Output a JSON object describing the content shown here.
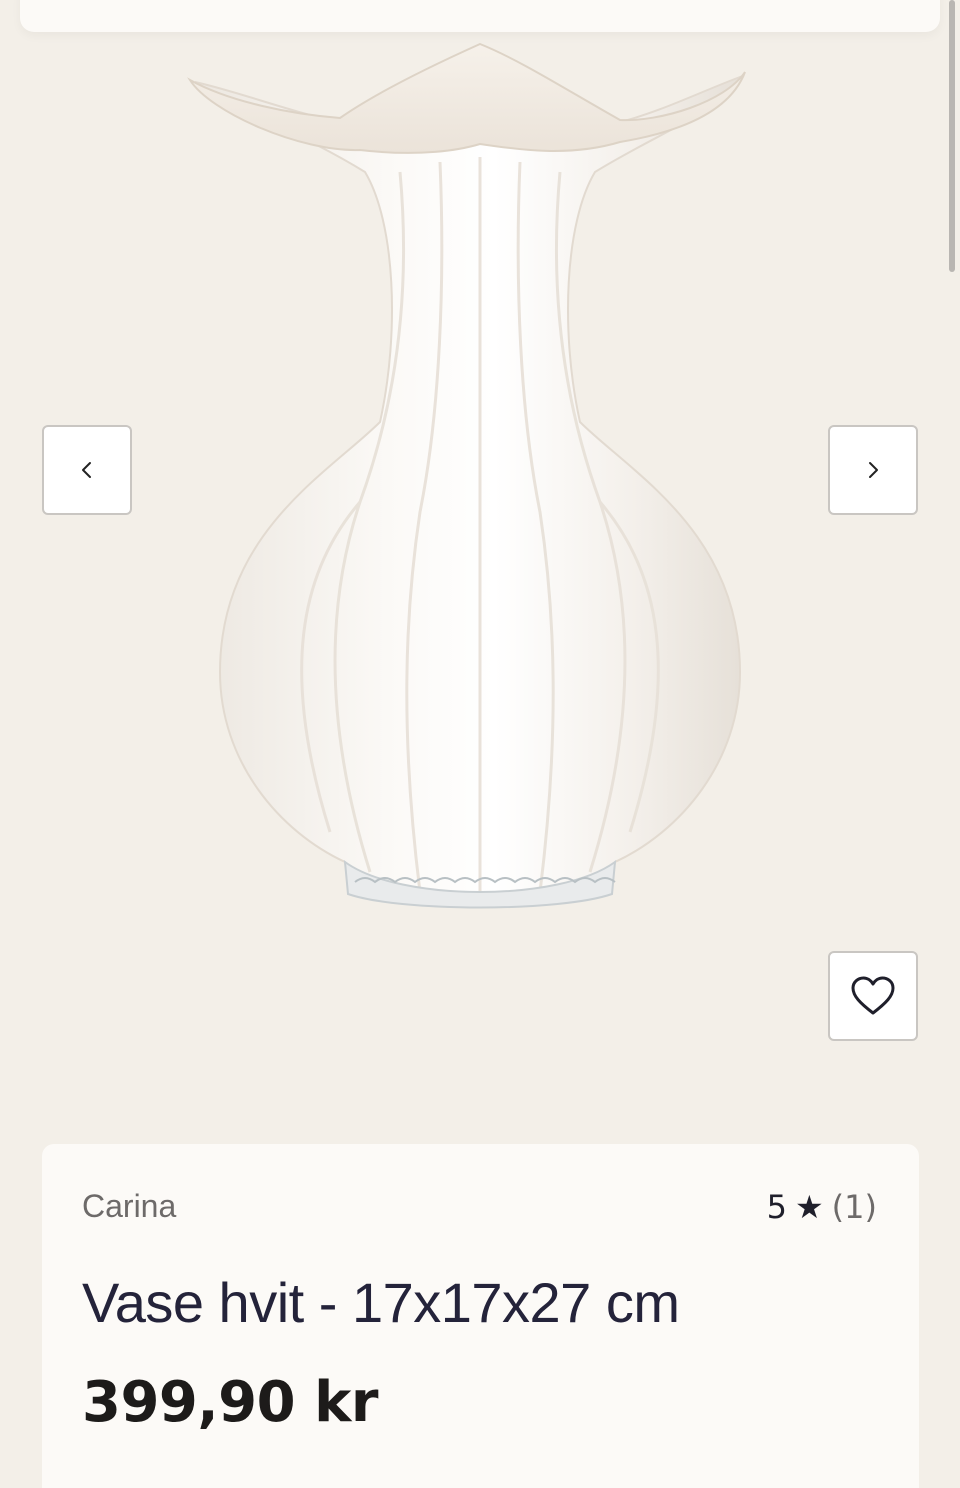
{
  "gallery": {
    "image_subject": "vase-image",
    "prev_label": "‹",
    "next_label": "›"
  },
  "product": {
    "brand": "Carina",
    "rating_value": "5",
    "rating_star": "★",
    "rating_count": "(1)",
    "title": "Vase hvit - 17x17x27 cm",
    "price": "399,90 kr"
  },
  "icons": {
    "prev": "chevron-left-icon",
    "next": "chevron-right-icon",
    "favorite": "heart-icon"
  },
  "colors": {
    "background": "#f3efe8",
    "card": "#fcfaf7",
    "title_text": "#24233a",
    "muted_text": "#6d6a69"
  }
}
